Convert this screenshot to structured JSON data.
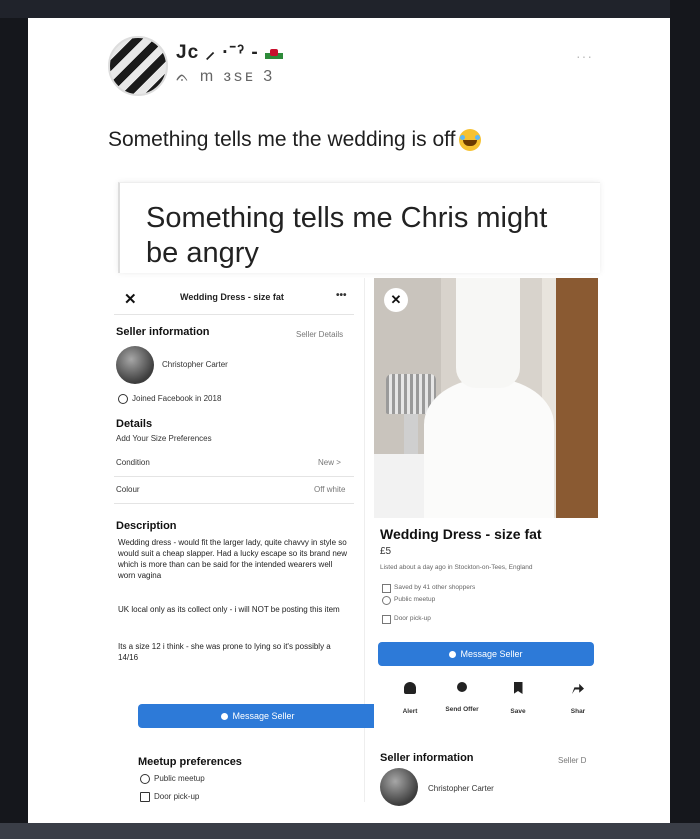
{
  "post": {
    "author": "Jc ⸝ ·⁻ˀ -",
    "meta": "ᨊ  m  ɜsᴇ  3",
    "more": "···",
    "text": "Something tells me the wedding is off"
  },
  "meme": {
    "caption": "Something tells me Chris might be angry"
  },
  "listing_left": {
    "close": "✕",
    "title": "Wedding Dress - size fat",
    "dots": "•••",
    "seller_info_label": "Seller information",
    "seller_details_link": "Seller Details",
    "seller_name": "Christopher Carter",
    "joined": "Joined Facebook in 2018",
    "details_label": "Details",
    "size_prefs": "Add Your Size Preferences",
    "condition_label": "Condition",
    "condition_value": "New >",
    "colour_label": "Colour",
    "colour_value": "Off white",
    "description_label": "Description",
    "description_p1": "Wedding dress - would fit the larger lady, quite chavvy in style so would suit a cheap slapper. Had a lucky escape so its brand new which is more than can be said for the intended wearers well worn vagina",
    "description_p2": "UK local only as its collect only - i will NOT be posting this item",
    "description_p3": "Its a size 12 i think - she was prone to lying so it's possibly a 14/16",
    "message_button": "Message Seller",
    "meetup_label": "Meetup preferences",
    "meetup_public": "Public meetup",
    "meetup_door": "Door pick-up"
  },
  "listing_right": {
    "close": "✕",
    "title": "Wedding Dress - size fat",
    "price": "£5",
    "listed": "Listed about a day ago in Stockton-on-Tees, England",
    "saved": "Saved by 41 other shoppers",
    "public_meetup": "Public meetup",
    "door_pickup": "Door pick-up",
    "message_button": "Message Seller",
    "actions": [
      "Alert",
      "Send Offer",
      "Save",
      "Shar"
    ],
    "seller_info_label": "Seller information",
    "seller_details_link": "Seller D",
    "seller_name": "Christopher Carter"
  },
  "colors": {
    "page_background": "#20232b",
    "card_background": "#ffffff",
    "facebook_blue": "#2d7ad8"
  }
}
